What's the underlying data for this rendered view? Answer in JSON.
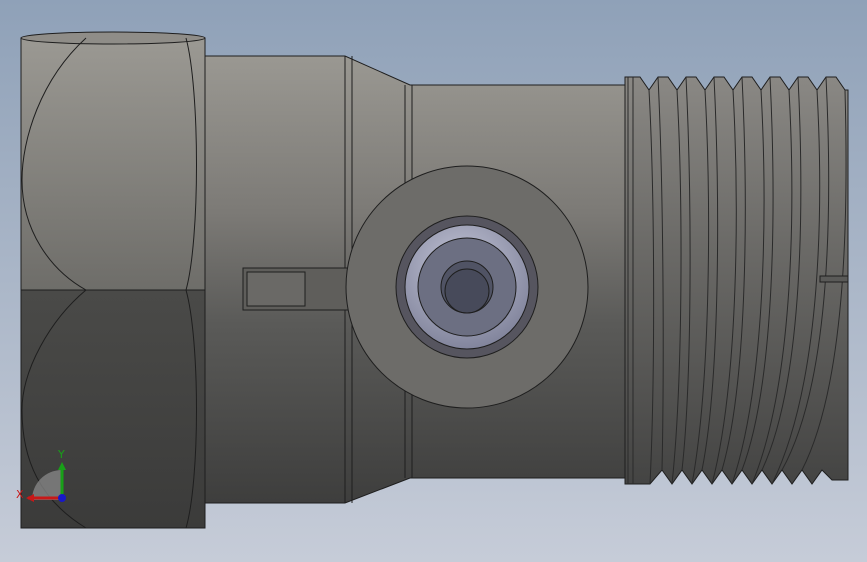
{
  "viewport": {
    "background_top": "#8fa1b8",
    "background_bottom": "#c6ccd8"
  },
  "model": {
    "body_light": "#8e8c87",
    "body_mid": "#6a6966",
    "body_dark": "#4a4a48",
    "edge_color": "#1e1e1e",
    "bore_color": "#a4a6bd"
  },
  "triad": {
    "x_label": "X",
    "y_label": "Y",
    "x_color": "#c81818",
    "y_color": "#18a018",
    "z_color": "#1818c8"
  }
}
